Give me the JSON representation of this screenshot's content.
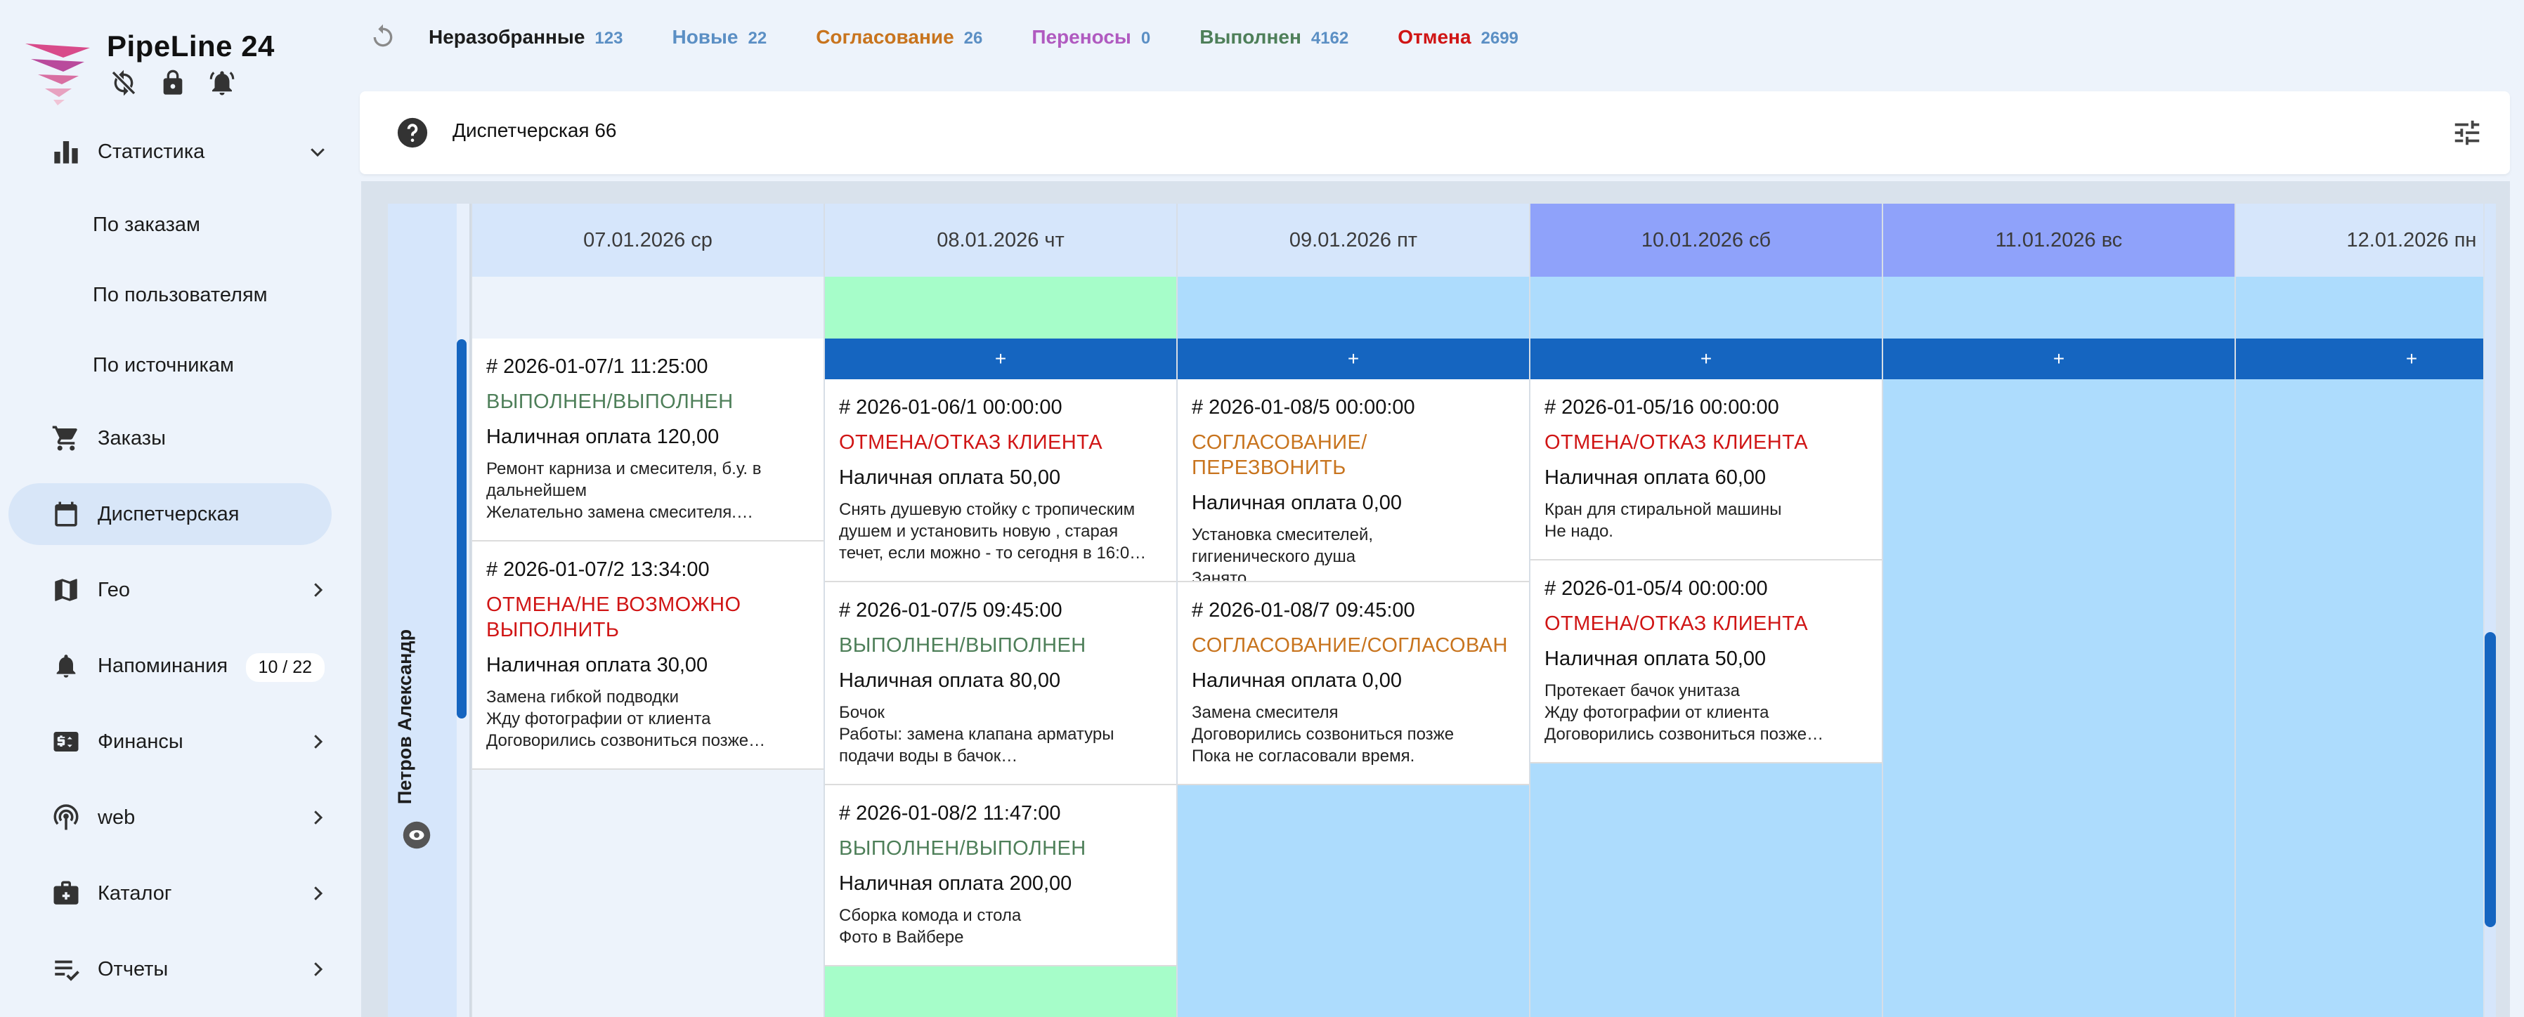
{
  "brand": {
    "title": "PipeLine 24"
  },
  "sidebar": {
    "items": [
      {
        "label": "Статистика",
        "icon": "bar-chart-icon",
        "arrow": "chevron-down-icon"
      },
      {
        "label": "По заказам"
      },
      {
        "label": "По пользователям"
      },
      {
        "label": "По источникам"
      },
      {
        "label": "Заказы",
        "icon": "cart-icon"
      },
      {
        "label": "Диспетчерская",
        "icon": "calendar-icon",
        "active": true
      },
      {
        "label": "Гео",
        "icon": "map-icon",
        "arrow": "chevron-right-icon"
      },
      {
        "label": "Напоминания",
        "icon": "bell-icon",
        "badge": "10 / 22"
      },
      {
        "label": "Финансы",
        "icon": "finance-icon",
        "arrow": "chevron-right-icon"
      },
      {
        "label": "web",
        "icon": "broadcast-icon",
        "arrow": "chevron-right-icon"
      },
      {
        "label": "Каталог",
        "icon": "catalog-icon",
        "arrow": "chevron-right-icon"
      },
      {
        "label": "Отчеты",
        "icon": "report-icon",
        "arrow": "chevron-right-icon"
      }
    ]
  },
  "status_tabs": [
    {
      "label": "Неразобранные",
      "count": "123",
      "color": "#1c1c1c"
    },
    {
      "label": "Новые",
      "count": "22",
      "color": "#5b8fc4"
    },
    {
      "label": "Согласование",
      "count": "26",
      "color": "#c8741e"
    },
    {
      "label": "Переносы",
      "count": "0",
      "color": "#b05ac0"
    },
    {
      "label": "Выполнен",
      "count": "4162",
      "color": "#4e7f59"
    },
    {
      "label": "Отмена",
      "count": "2699",
      "color": "#d01515"
    }
  ],
  "panel": {
    "title": "Диспетчерская 66"
  },
  "resource": {
    "name": "Петров Александр"
  },
  "colors": {
    "done": "#4e7f59",
    "cancel": "#d01515",
    "agree": "#c8741e",
    "weekend": "#8fa2fa",
    "free_green": "#a6fdc9",
    "free_blue": "#addcfd",
    "accent": "#1565c0"
  },
  "days": [
    {
      "label": "07.01.2026 ср",
      "weekend": false,
      "strip": "#edf3fb",
      "body": "#edf3fb",
      "add": "",
      "cards": [
        {
          "num": "# 2026-01-07/1 11:25:00",
          "status": "ВЫПОЛНЕН/ВЫПОЛНЕН",
          "kind": "done",
          "pay": "Наличная оплата 120,00",
          "note": "Ремонт карниза и смесителя, б.у. в\nдальнейшем\nЖелательно замена смесителя.…"
        },
        {
          "num": "# 2026-01-07/2 13:34:00",
          "status": "ОТМЕНА/НЕ ВОЗМОЖНО\nВЫПОЛНИТЬ",
          "kind": "cancel",
          "pay": "Наличная оплата 30,00",
          "note": "Замена гибкой подводки\nЖду фотографии от клиента\nДоговорились созвониться позже…"
        }
      ]
    },
    {
      "label": "08.01.2026 чт",
      "weekend": false,
      "strip": "#a6fdc9",
      "body": "#a6fdc9",
      "add": "+",
      "cards": [
        {
          "num": "# 2026-01-06/1 00:00:00",
          "status": "ОТМЕНА/ОТКАЗ КЛИЕНТА",
          "kind": "cancel",
          "pay": "Наличная оплата 50,00",
          "note": "Снять душевую стойку с тропическим\nдушем и установить новую , старая\nтечет, если можно - то сегодня в 16:0…"
        },
        {
          "num": "# 2026-01-07/5 09:45:00",
          "status": "ВЫПОЛНЕН/ВЫПОЛНЕН",
          "kind": "done",
          "pay": "Наличная оплата 80,00",
          "note": "Бочок\nРаботы: замена клапана арматуры\nподачи воды в бачок…"
        },
        {
          "num": "# 2026-01-08/2 11:47:00",
          "status": "ВЫПОЛНЕН/ВЫПОЛНЕН",
          "kind": "done",
          "pay": "Наличная оплата 200,00",
          "note": "Сборка комода и стола\nФото в Вайбере"
        }
      ]
    },
    {
      "label": "09.01.2026 пт",
      "weekend": false,
      "strip": "#addcfd",
      "body": "#addcfd",
      "add": "+",
      "cards": [
        {
          "num": "# 2026-01-08/5 00:00:00",
          "status": "СОГЛАСОВАНИЕ/ПЕРЕЗВОНИТЬ",
          "kind": "agree",
          "pay": "Наличная оплата 0,00",
          "note": "Установка смесителей,\nгигиенического душа\nЗанято.…"
        },
        {
          "num": "# 2026-01-08/7 09:45:00",
          "status": "СОГЛАСОВАНИЕ/СОГЛАСОВАН",
          "kind": "agree",
          "pay": "Наличная оплата 0,00",
          "note": "Замена смесителя\nДоговорились созвониться позже\nПока не согласовали время."
        }
      ]
    },
    {
      "label": "10.01.2026 сб",
      "weekend": true,
      "strip": "#addcfd",
      "body": "#addcfd",
      "add": "+",
      "cards": [
        {
          "num": "# 2026-01-05/16 00:00:00",
          "status": "ОТМЕНА/ОТКАЗ КЛИЕНТА",
          "kind": "cancel",
          "pay": "Наличная оплата 60,00",
          "note": "Кран для стиральной машины\nНе надо."
        },
        {
          "num": "# 2026-01-05/4 00:00:00",
          "status": "ОТМЕНА/ОТКАЗ КЛИЕНТА",
          "kind": "cancel",
          "pay": "Наличная оплата 50,00",
          "note": "Протекает бачок унитаза\nЖду фотографии от клиента\nДоговорились созвониться позже…"
        }
      ]
    },
    {
      "label": "11.01.2026 вс",
      "weekend": true,
      "strip": "#addcfd",
      "body": "#addcfd",
      "add": "+",
      "cards": []
    },
    {
      "label": "12.01.2026 пн",
      "weekend": false,
      "strip": "#addcfd",
      "body": "#addcfd",
      "add": "+",
      "cards": []
    }
  ]
}
